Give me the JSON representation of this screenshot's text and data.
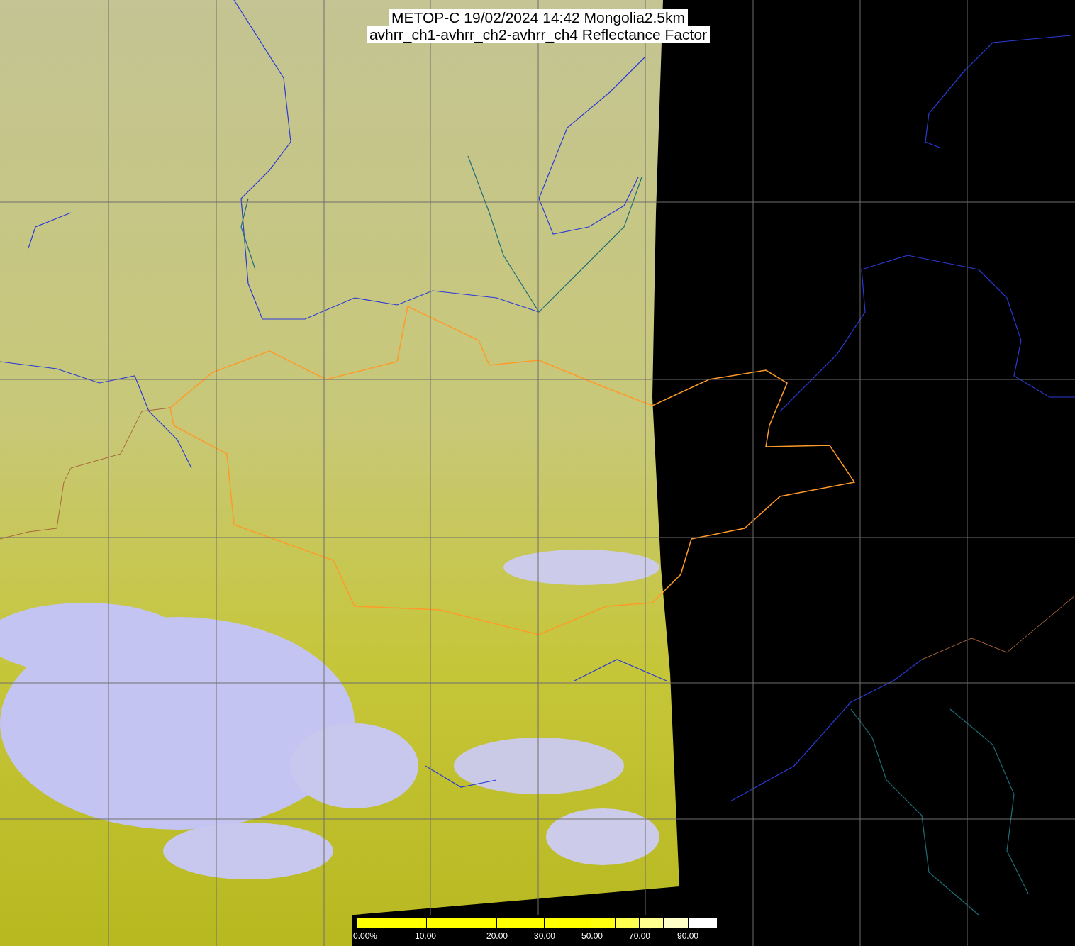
{
  "title": {
    "lines": [
      "METOP-C 19/02/2024 14:42 Mongolia2.5km",
      "avhrr_ch1-avhrr_ch2-avhrr_ch4 Reflectance Factor"
    ]
  },
  "colorbar": {
    "labels": [
      "0.00%",
      "10.00",
      "20.00",
      "30.00",
      "50.00",
      "70.00",
      "90.00"
    ]
  }
}
